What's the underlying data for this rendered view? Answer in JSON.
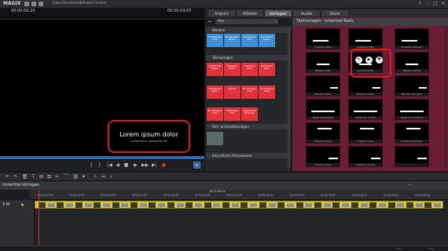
{
  "app": {
    "logo": "MAGIX",
    "menu": [
      "Datei",
      "Bearbeiten",
      "Effekte",
      "Fenster"
    ],
    "window_controls": [
      "?",
      "–",
      "□",
      "✕"
    ]
  },
  "preview": {
    "timecode_left": "00:00:00:20",
    "timecode_right": "00:00:04:05",
    "overlay_title": "Lorem ipsum dolor",
    "overlay_subtitle": "Consectetur adipiscing elit"
  },
  "tabs": [
    {
      "label": "Import",
      "active": false
    },
    {
      "label": "Effekte",
      "active": false
    },
    {
      "label": "Vorlagen",
      "active": true
    },
    {
      "label": "Audio",
      "active": false
    },
    {
      "label": "Store",
      "active": false
    }
  ],
  "categories": {
    "filter": "Alle",
    "sections": [
      "Blenden",
      "Titelvorlagen",
      "Film- & Schnittvorlagen",
      "Intro-/Outro-Animationen"
    ],
    "blenden": [
      "3D Wallpaper Ende",
      "3D Wallpaper Beginn",
      "3D Tombola Ende",
      "3D Tombola Beginn"
    ],
    "titel": [
      "Schiffkurven Beginn",
      "Kategorie Beginn",
      "Unterstrich Basis",
      "Rückblende Basis",
      "Zoomsprung Beginn",
      "Eigenes",
      "3D Animation Ende",
      "3D Animation Basis",
      "3D Animation Ende",
      "Titelmodus Ende",
      "Dynamische Titel Ende",
      ""
    ]
  },
  "templates": {
    "header": "Titelvorlagen - Untertitel Basis",
    "items": [
      "Ausseres links",
      "Ausseres Mitte",
      "Ausseres zentriert",
      "Bekannt links",
      "Inneres rechts",
      "Bekannt rechts",
      "Blöcken Basis",
      "Blöcken rechts",
      "Blöcken zentriert",
      "Einfachbreit Basis",
      "Einfachen rechts",
      "Einfachen zentriert",
      "Freeform Basis",
      "Freeform links",
      "Freeform zentriert",
      "Freeform links",
      "Freeform rechts",
      ""
    ],
    "hover_icons": [
      "edit-icon",
      "play-icon",
      "heart-icon"
    ]
  },
  "timeline": {
    "title": "Untertitel-Vorlagen",
    "top_timecode": "00:07:00:04",
    "ruler": [
      "00:00:00:00",
      "00:00:04:00",
      "00:00:08:00",
      "00:00:12:00",
      "00:00:16:00",
      "00:00:20:00",
      "00:00:24:00",
      "00:00:28:00",
      "00:00:32:00",
      "00:00:36:00",
      "00:00:40:00",
      "00:00:44:00",
      "00:00:48:00"
    ],
    "track_label": "S M",
    "zoom": "11%",
    "status_right": "52%"
  }
}
